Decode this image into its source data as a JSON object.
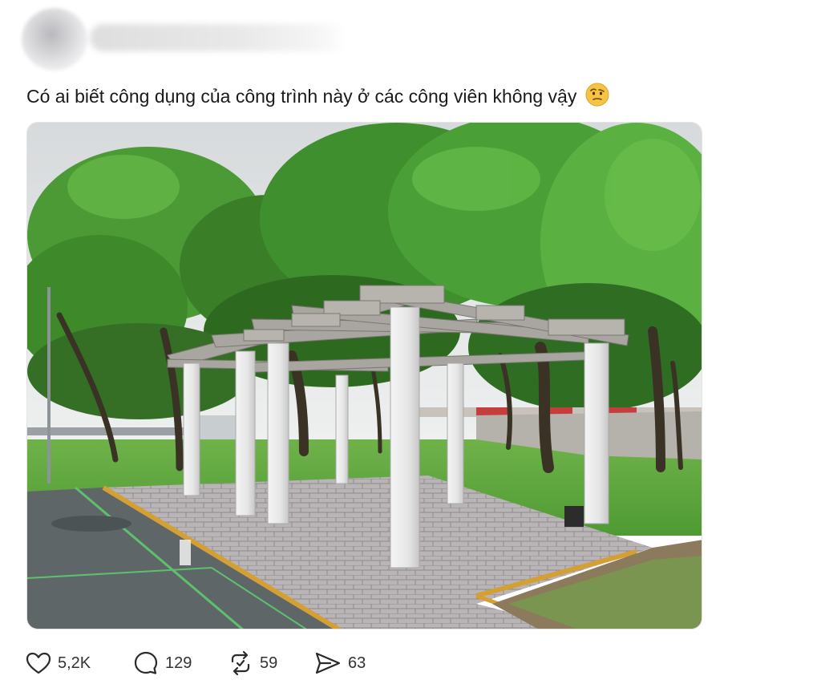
{
  "post": {
    "text": "Có ai biết công dụng của công trình này ở các công viên không vậy",
    "emoji": "face-with-raised-eyebrow"
  },
  "photo": {
    "subject": "pergola-in-park"
  },
  "actions": {
    "like_count": "5,2K",
    "comment_count": "129",
    "repost_count": "59",
    "share_count": "63"
  },
  "colors": {
    "text": "#1a1a1a",
    "icon": "#2a2a2a",
    "emoji": "#f6c343"
  }
}
